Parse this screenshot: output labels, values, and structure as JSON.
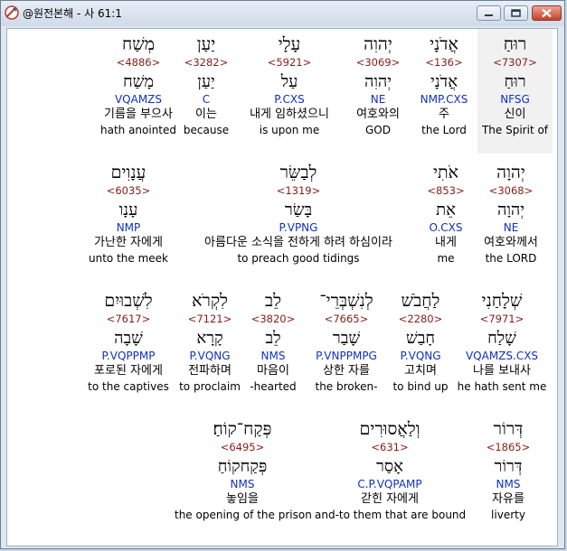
{
  "window": {
    "title": "@원전본해 - 사 61:1",
    "buttons": {
      "minimize": "minimize-icon",
      "maximize": "maximize-icon",
      "close": "close-icon"
    }
  },
  "rows": [
    {
      "words": [
        {
          "heb": "מְשַׁח",
          "strong": "<4886>",
          "root": "מָשַׁח",
          "parse": "VQAMZS",
          "kor": "기름을 부으사",
          "eng": "hath anointed"
        },
        {
          "heb": "יַעַן",
          "strong": "<3282>",
          "root": "יַעַן",
          "parse": "C",
          "kor": "이는",
          "eng": "because"
        },
        {
          "heb": "עָלָי",
          "strong": "<5921>",
          "root": "עַל",
          "parse": "P.CXS",
          "kor": "내게 임하셨으니",
          "eng": "is upon me"
        },
        {
          "heb": "יְהוִה",
          "strong": "<3069>",
          "root": "יְהוִה",
          "parse": "NE",
          "kor": "여호와의",
          "eng": "GOD"
        },
        {
          "heb": "אֲדֹנָי",
          "strong": "<136>",
          "root": "אֲדֹנָי",
          "parse": "NMP.CXS",
          "kor": "주",
          "eng": "the Lord"
        },
        {
          "heb": "רוּחַ",
          "strong": "<7307>",
          "root": "רוּחַ",
          "parse": "NFSG",
          "kor": "신이",
          "eng": "The Spirit of"
        }
      ]
    },
    {
      "words": [
        {
          "heb": "עֲנָוִים",
          "strong": "<6035>",
          "root": "עָנָו",
          "parse": "NMP",
          "kor": "가난한 자에게",
          "eng": "unto the meek"
        },
        {
          "heb": "לְבַשֵּׂר",
          "strong": "<1319>",
          "root": "בָּשַׂר",
          "parse": "P.VPNG",
          "kor": "아름다운 소식을 전하게 하려 하심이라",
          "eng": "to preach good tidings"
        },
        {
          "heb": "אֹתִי",
          "strong": "<853>",
          "root": "אֵת",
          "parse": "O.CXS",
          "kor": "내게",
          "eng": "me"
        },
        {
          "heb": "יְהוָה",
          "strong": "<3068>",
          "root": "יְהוָה",
          "parse": "NE",
          "kor": "여호와께서",
          "eng": "the LORD"
        }
      ]
    },
    {
      "words": [
        {
          "heb": "לִשְׁבוּיִם",
          "strong": "<7617>",
          "root": "שָׁבָה",
          "parse": "P.VQPPMP",
          "kor": "포로된 자에게",
          "eng": "to the captives"
        },
        {
          "heb": "לִקְרֹא",
          "strong": "<7121>",
          "root": "קָרָא",
          "parse": "P.VQNG",
          "kor": "전파하며",
          "eng": "to proclaim"
        },
        {
          "heb": "לֵב",
          "strong": "<3820>",
          "root": "לֵב",
          "parse": "NMS",
          "kor": "마음이",
          "eng": "-hearted"
        },
        {
          "heb": "לְנִשְׁבְּרֵי־",
          "strong": "<7665>",
          "root": "שָׁבַר",
          "parse": "P.VNPPMPG",
          "kor": "상한 자를",
          "eng": "the broken-"
        },
        {
          "heb": "לַחֲבֹשׁ",
          "strong": "<2280>",
          "root": "חָבַשׁ",
          "parse": "P.VQNG",
          "kor": "고치며",
          "eng": "to bind up"
        },
        {
          "heb": "שְׁלָחַנִי",
          "strong": "<7971>",
          "root": "שָׁלַח",
          "parse": "VQAMZS.CXS",
          "kor": "나를 보내사",
          "eng": "he hath sent me"
        }
      ]
    },
    {
      "words": [
        {
          "heb": "פְּקַח־קוֹחַ׃",
          "strong": "<6495>",
          "root": "פְּקַחקוֹחַ",
          "parse": "NMS",
          "kor": "놓임을",
          "eng": "the opening of the prison"
        },
        {
          "heb": "וְלַאֲסוּרִים",
          "strong": "<631>",
          "root": "אָסַר",
          "parse": "C.P.VQPAMP",
          "kor": "갇힌 자에게",
          "eng": "and-to them that are bound"
        },
        {
          "heb": "דְּרוֹר",
          "strong": "<1865>",
          "root": "דְּרוֹר",
          "parse": "NMS",
          "kor": "자유를",
          "eng": "liverty"
        }
      ]
    }
  ]
}
